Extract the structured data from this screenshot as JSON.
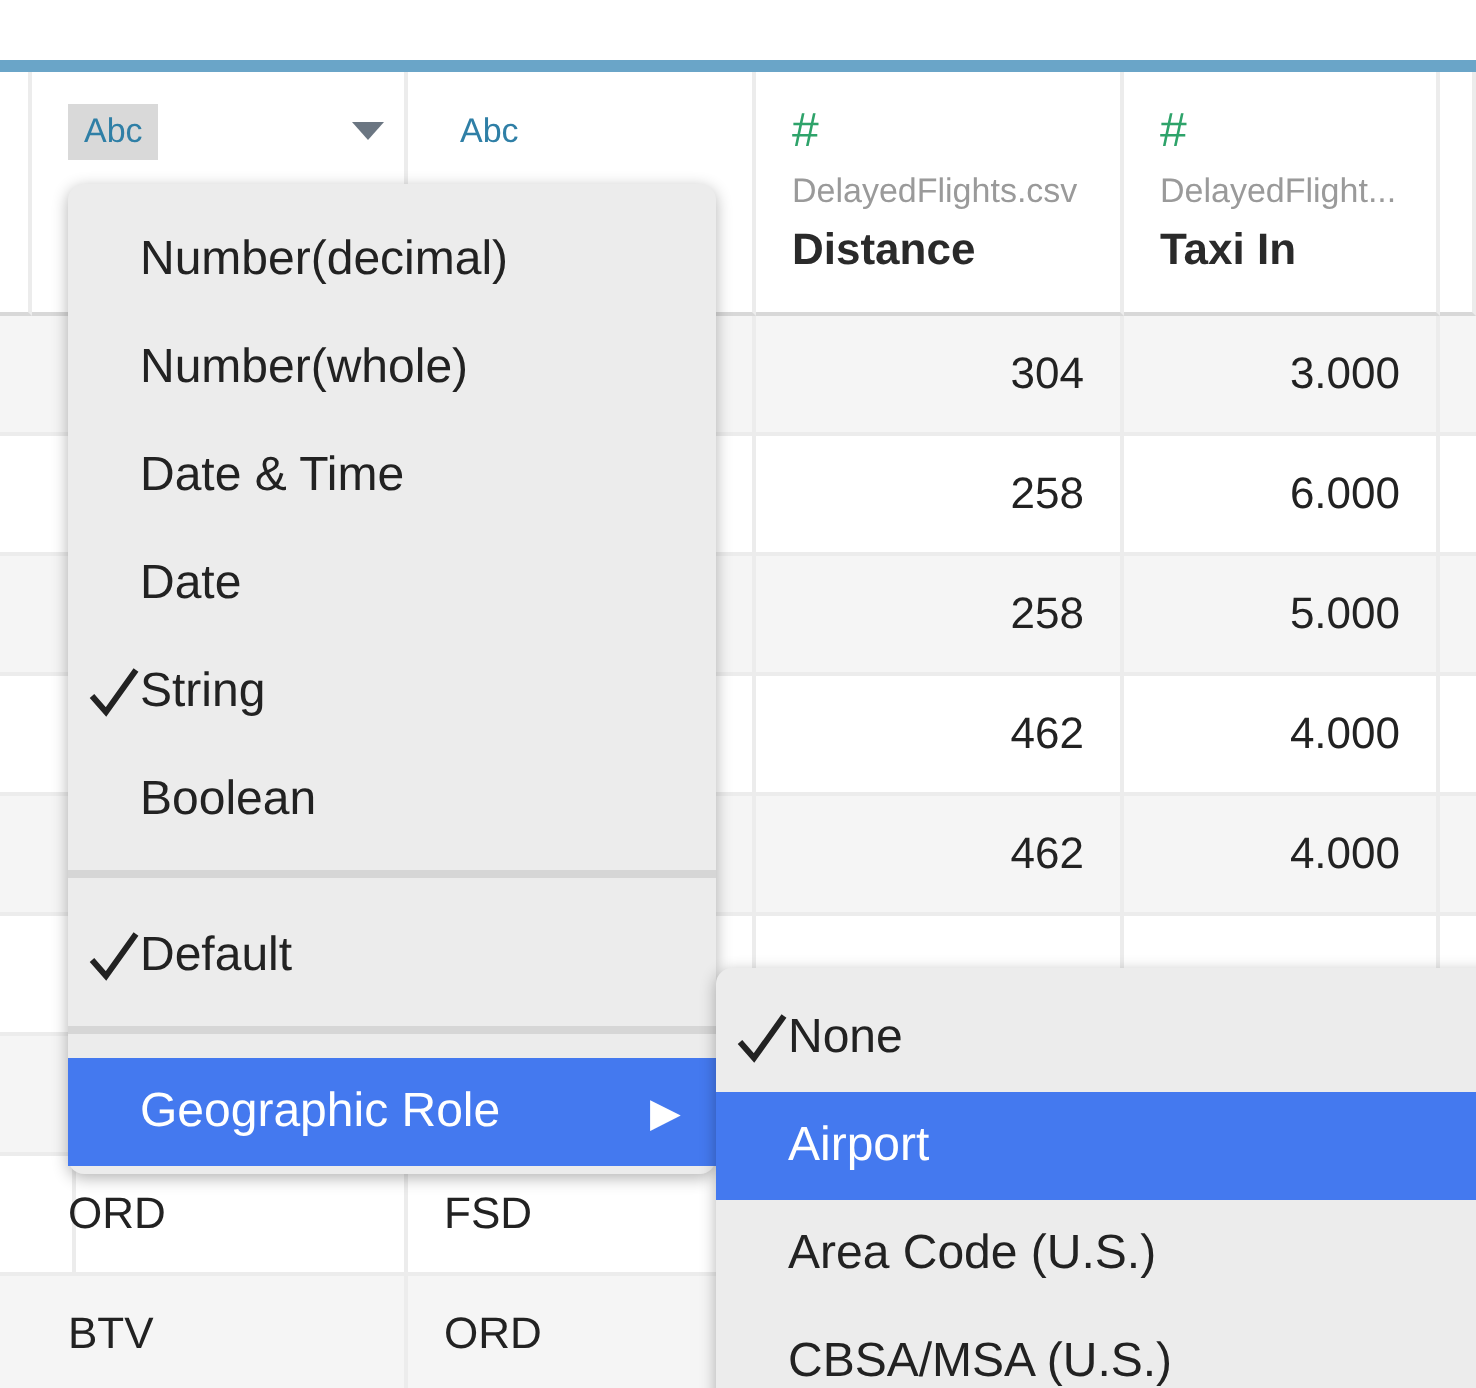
{
  "table": {
    "columns": [
      {
        "kind": "text",
        "type_label": "Abc",
        "menu_open": true
      },
      {
        "kind": "text",
        "type_label": "Abc",
        "menu_open": false
      },
      {
        "kind": "number",
        "type_label": "#",
        "source": "DelayedFlights.csv",
        "name": "Distance",
        "menu_open": false
      },
      {
        "kind": "number",
        "type_label": "#",
        "source": "DelayedFlight...",
        "name": "Taxi In",
        "menu_open": false
      }
    ],
    "rows": [
      {
        "column_3": "304",
        "column_4": "3.000"
      },
      {
        "column_3": "258",
        "column_4": "6.000"
      },
      {
        "column_3": "258",
        "column_4": "5.000"
      },
      {
        "column_3": "462",
        "column_4": "4.000"
      },
      {
        "column_3": "462",
        "column_4": "4.000"
      },
      {},
      {},
      {
        "column_1": "ORD",
        "column_2": "FSD"
      },
      {
        "column_1": "BTV",
        "column_2": "ORD"
      }
    ]
  },
  "type_menu": {
    "items": [
      {
        "kind": "item",
        "label": "Number(decimal)",
        "checked": false,
        "selected": false
      },
      {
        "kind": "item",
        "label": "Number(whole)",
        "checked": false,
        "selected": false
      },
      {
        "kind": "item",
        "label": "Date & Time",
        "checked": false,
        "selected": false
      },
      {
        "kind": "item",
        "label": "Date",
        "checked": false,
        "selected": false
      },
      {
        "kind": "item",
        "label": "String",
        "checked": true,
        "selected": false
      },
      {
        "kind": "item",
        "label": "Boolean",
        "checked": false,
        "selected": false
      },
      {
        "kind": "separator"
      },
      {
        "kind": "item",
        "label": "Default",
        "checked": true,
        "selected": false
      },
      {
        "kind": "separator"
      },
      {
        "kind": "submenu",
        "label": "Geographic Role",
        "checked": false,
        "selected": true,
        "arrow": "▶"
      }
    ]
  },
  "geographic_role_menu": {
    "items": [
      {
        "kind": "item",
        "label": "None",
        "checked": true,
        "selected": false
      },
      {
        "kind": "item",
        "label": "Airport",
        "checked": false,
        "selected": true
      },
      {
        "kind": "item",
        "label": "Area Code (U.S.)",
        "checked": false,
        "selected": false
      },
      {
        "kind": "item",
        "label": "CBSA/MSA (U.S.)",
        "checked": false,
        "selected": false
      }
    ]
  }
}
